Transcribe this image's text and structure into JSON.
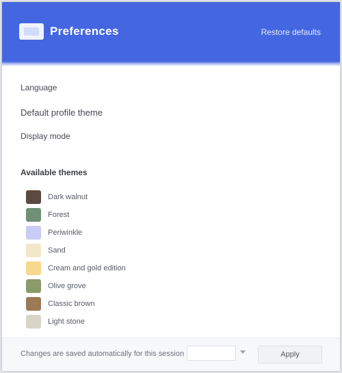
{
  "header": {
    "title": "Preferences",
    "link_label": "Restore defaults"
  },
  "fields": {
    "line1": "Language",
    "line2": "Default profile theme",
    "line3": "Display mode"
  },
  "section": {
    "title": "Available themes",
    "items": [
      {
        "label": "Dark walnut",
        "color": "#5c4a40"
      },
      {
        "label": "Forest",
        "color": "#6f8f76"
      },
      {
        "label": "Periwinkle",
        "color": "#c9ccf3"
      },
      {
        "label": "Sand",
        "color": "#f3e7c9"
      },
      {
        "label": "Cream and gold edition",
        "color": "#f8d88d"
      },
      {
        "label": "Olive grove",
        "color": "#8a9a6a"
      },
      {
        "label": "Classic brown",
        "color": "#9b7a55"
      },
      {
        "label": "Light stone",
        "color": "#d7d5c8"
      }
    ]
  },
  "footer": {
    "note": "Changes are saved automatically for this session",
    "input_value": "",
    "button_label": "Apply"
  },
  "colors": {
    "header": "#4466e0"
  }
}
